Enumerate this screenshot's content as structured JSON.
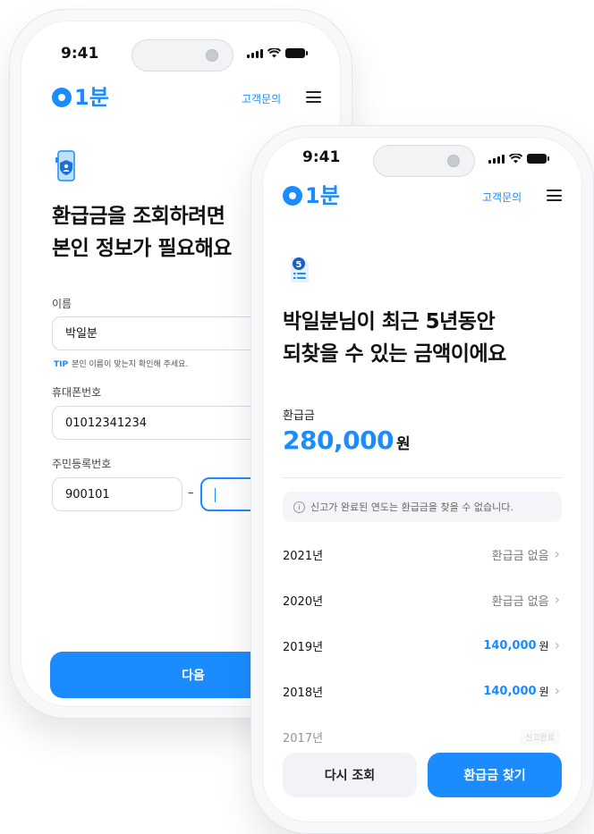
{
  "status": {
    "time": "9:41"
  },
  "brand": {
    "logo_text": "1분",
    "inquiry": "고객문의"
  },
  "colors": {
    "accent": "#1a8cff",
    "text": "#111111",
    "muted": "#777777"
  },
  "form_screen": {
    "icon": "shield-phone-icon",
    "headline_line1": "환급금을 조회하려면",
    "headline_line2": "본인 정보가 필요해요",
    "name_label": "이름",
    "name_value": "박일분",
    "tip_tag": "TIP",
    "tip_text": "본인 이름이 맞는지 확인해 주세요.",
    "phone_label": "휴대폰번호",
    "phone_value": "01012341234",
    "rrn_label": "주민등록번호",
    "rrn_front": "900101",
    "rrn_separator": "–",
    "next_button": "다음"
  },
  "result_screen": {
    "icon": "document-badge-icon",
    "headline_line1": "박일분님이 최근 5년동안",
    "headline_line2": "되찾을 수 있는 금액이에요",
    "refund_label": "환급금",
    "refund_amount": "280,000",
    "refund_unit": "원",
    "notice": "신고가 완료된 연도는 환급금을 찾을 수 없습니다.",
    "years": [
      {
        "year": "2021년",
        "status": "환급금 없음"
      },
      {
        "year": "2020년",
        "status": "환급금 없음"
      },
      {
        "year": "2019년",
        "amount": "140,000",
        "unit": "원"
      },
      {
        "year": "2018년",
        "amount": "140,000",
        "unit": "원"
      },
      {
        "year": "2017년",
        "badge": "신고완료"
      }
    ],
    "retry_button": "다시 조회",
    "find_button": "환급금 찾기"
  }
}
